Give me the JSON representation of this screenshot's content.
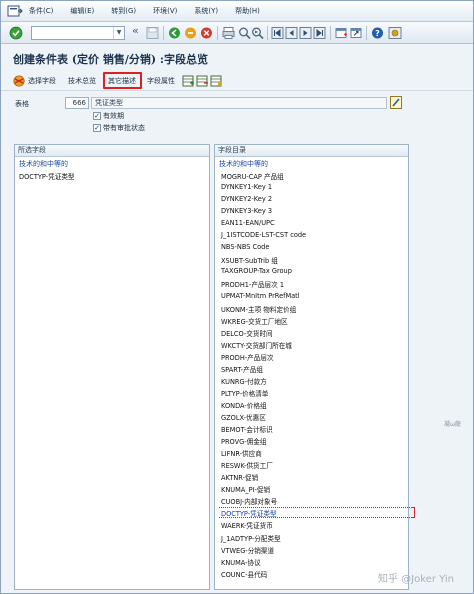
{
  "menu": {
    "items": [
      "条件(C)",
      "编辑(E)",
      "转到(G)",
      "环境(V)",
      "系统(Y)",
      "帮助(H)"
    ]
  },
  "toolbar": {
    "command_field_value": "",
    "collapse_glyph": "«"
  },
  "page": {
    "title": "创建条件表 (定价 销售/分销) :字段总览"
  },
  "app_toolbar": {
    "select_fields_label": "选择字段",
    "tech_overview_label": "技术总览",
    "other_desc_label": "其它描述",
    "field_attr_label": "字段属性"
  },
  "header": {
    "table_label": "表格",
    "table_number": "666",
    "table_description": "凭证类型",
    "checkbox_valid_label": "有效期",
    "checkbox_valid_checked": true,
    "checkbox_release_label": "带有审批状态",
    "checkbox_release_checked": true
  },
  "selected_panel": {
    "header": "所选字段",
    "root": "技术的和中等的",
    "items": [
      "DOCTYP-凭证类型"
    ]
  },
  "catalog_panel": {
    "header": "字段目录",
    "root": "技术的和中等的",
    "items": [
      "MOGRU-CAP 产品组",
      "DYNKEY1-Key 1",
      "DYNKEY2-Key 2",
      "DYNKEY3-Key 3",
      "EAN11-EAN/UPC",
      "J_1ISTCODE-LST-CST code",
      "NBS-NBS Code",
      "XSUBT-SubTrib 组",
      "TAXGROUP-Tax Group",
      "PRODH1-产品层次 1",
      "UPMAT-MnItm PrRefMatl",
      "UKONM-主项 物料定价组",
      "WKREG-交货工厂地区",
      "DELCO-交货时间",
      "WKCTY-交货部门所在城",
      "PRODH-产品层次",
      "SPART-产品组",
      "KUNRG-付款方",
      "PLTYP-价格清单",
      "KONDA-价格组",
      "GZOLX-优惠区",
      "BEMOT-会计标识",
      "PROVG-佣金组",
      "LIFNR-供应商",
      "RESWK-供货工厂",
      "AKTNR-促销",
      "KNUMA_PI-促销",
      "CUOBJ-内部对象号",
      "DOCTYP-凭证类型",
      "WAERK-凭证货币",
      "J_1ADTYP-分配类型",
      "VTWEG-分销渠道",
      "KNUMA-协议",
      "COUNC-县代码"
    ],
    "selected_index": 28
  },
  "watermark": {
    "text": "知乎 @Joker Yin",
    "small": "凝ω龍"
  },
  "colors": {
    "highlight_box": "#e02020",
    "link_blue": "#1a49a5",
    "panel_border": "#9fb3c8"
  }
}
